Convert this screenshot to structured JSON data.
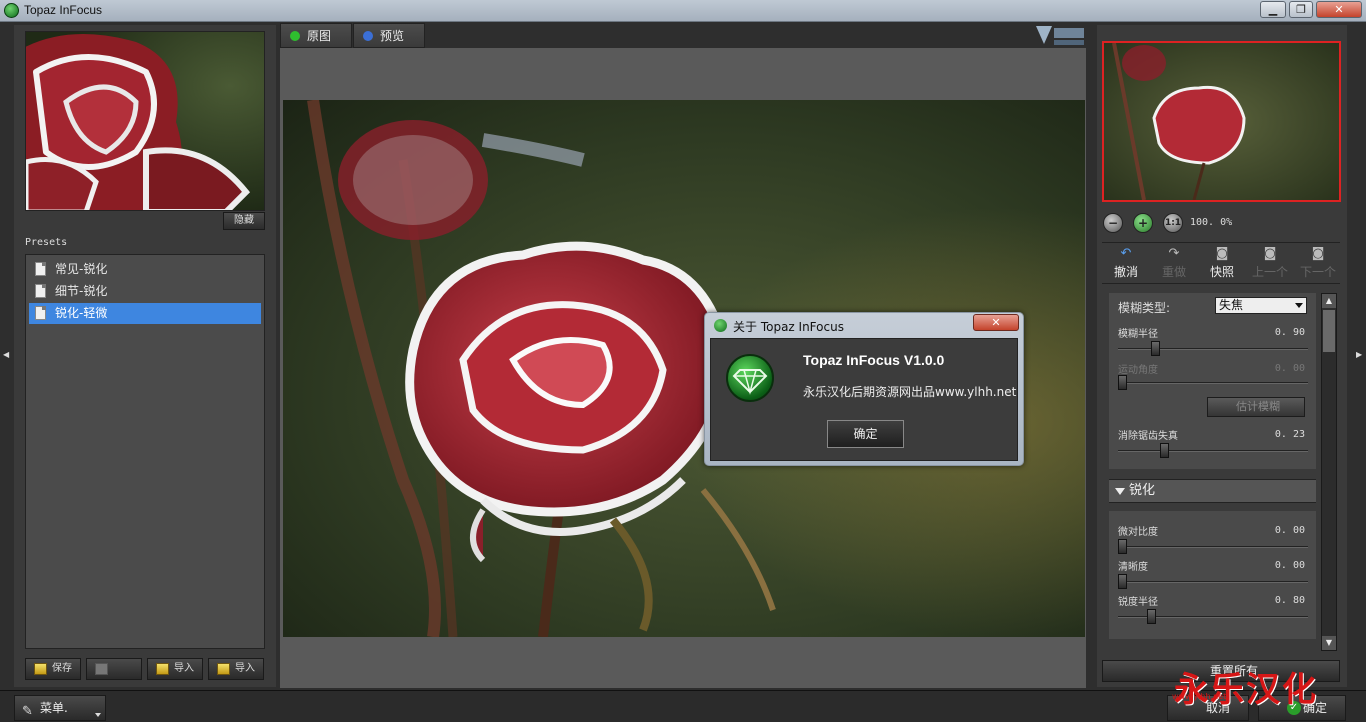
{
  "window": {
    "title": "Topaz InFocus"
  },
  "left": {
    "hide_label": "隐藏",
    "presets_label": "Presets",
    "presets": [
      {
        "label": "常见-锐化",
        "selected": false
      },
      {
        "label": "细节-锐化",
        "selected": false
      },
      {
        "label": "锐化-轻微",
        "selected": true
      }
    ],
    "buttons": [
      {
        "label": "保存",
        "enabled": true
      },
      {
        "label": "",
        "enabled": false
      },
      {
        "label": "导入",
        "enabled": true
      },
      {
        "label": "导入",
        "enabled": true
      }
    ]
  },
  "main": {
    "tabs": [
      {
        "label": "原图",
        "dot_color": "#2fbf2f"
      },
      {
        "label": "预览",
        "dot_color": "#3b6fd6"
      }
    ]
  },
  "right": {
    "zoom_value": "100. 0%",
    "toolbar": {
      "undo": "撤消",
      "redo": "重做",
      "snapshot": "快照",
      "prev": "上一个",
      "next": "下一个"
    },
    "blur": {
      "type_label": "模糊类型:",
      "type_value": "失焦",
      "radius_label": "模糊半径",
      "radius_value": "0. 90",
      "radius_level": 0.18,
      "motion_label": "运动角度",
      "motion_value": "0. 00",
      "motion_level": 0.0,
      "estimate_label": "估计模糊",
      "antialias_label": "消除锯齿失真",
      "antialias_value": "0. 23",
      "antialias_level": 0.23
    },
    "sharpen": {
      "header": "锐化",
      "contrast_label": "微对比度",
      "contrast_value": "0. 00",
      "contrast_level": 0.0,
      "clarity_label": "清晰度",
      "clarity_value": "0. 00",
      "clarity_level": 0.0,
      "radius_label": "锐度半径",
      "radius_value": "0. 80",
      "radius_level": 0.16
    },
    "reset_all": "重置所有"
  },
  "bottom": {
    "menu_label": "菜单.",
    "cancel_label": "取消",
    "ok_label": "确定",
    "watermark": "永乐汉化",
    "watermark_small": "www.ylhh.net"
  },
  "about": {
    "title": "关于 Topaz InFocus",
    "app_name": "Topaz InFocus V1.0.0",
    "subtitle": "永乐汉化后期资源网出品www.ylhh.net",
    "ok": "确定"
  },
  "colors": {
    "accent": "#3e86e0",
    "nav_frame": "#dd2222",
    "close_button": "#c4432b",
    "brand_green": "#1a8c2a"
  }
}
